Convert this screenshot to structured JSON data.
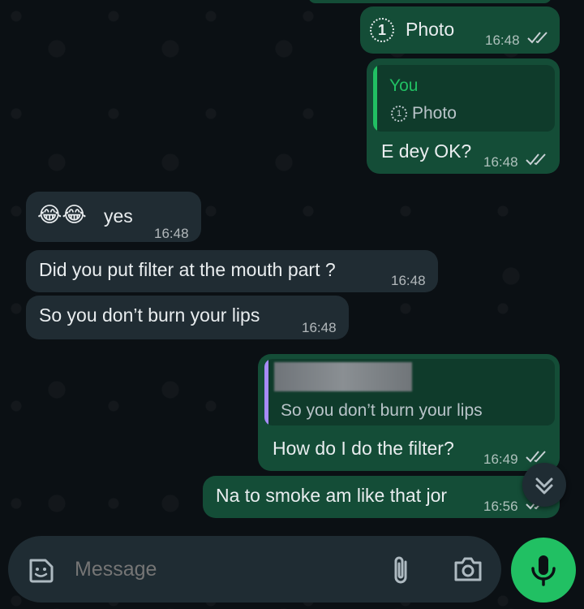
{
  "messages": [
    {
      "text": "Photo",
      "time": "16:48",
      "dir": "out",
      "once_symbol": "1"
    },
    {
      "quote_author": "You",
      "quote_text": "Photo",
      "quote_symbol": "1",
      "text": "E dey OK?",
      "time": "16:48",
      "dir": "out"
    },
    {
      "emoji": "😂😂",
      "text": "yes",
      "time": "16:48",
      "dir": "in"
    },
    {
      "text": "Did you put filter at the mouth part ?",
      "time": "16:48",
      "dir": "in"
    },
    {
      "text": "So you don’t burn your lips",
      "time": "16:48",
      "dir": "in"
    },
    {
      "quote_text": "So you don’t burn your lips",
      "text": "How do I do the filter?",
      "time": "16:49",
      "dir": "out"
    },
    {
      "text": "Na to smoke am like that jor",
      "time": "16:56",
      "dir": "out"
    }
  ],
  "composer": {
    "placeholder": "Message"
  },
  "colors": {
    "outgoing_bubble": "#144d37",
    "incoming_bubble": "#202c33",
    "accent_green": "#21c063",
    "quote_bar_self": "#21c063",
    "quote_bar_other": "#a78bfa",
    "tick_color": "#c9d1d5"
  },
  "icons": [
    "double-check-icon",
    "view-once-icon",
    "sticker-icon",
    "attach-icon",
    "camera-icon",
    "mic-icon",
    "scroll-down-icon"
  ]
}
